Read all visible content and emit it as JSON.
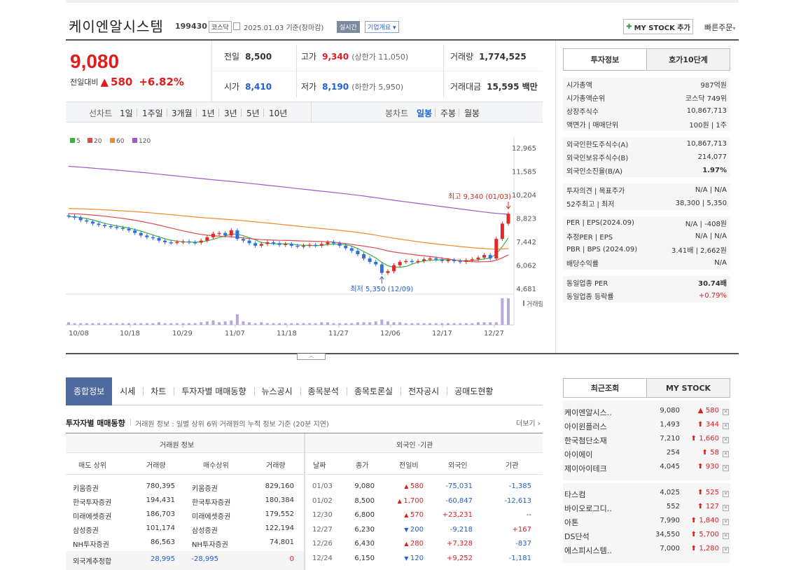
{
  "header": {
    "name": "케이엔알시스템",
    "code": "199430",
    "market": "코스닥",
    "date": "2025.01.03",
    "basis": "기준(장마감)",
    "realtime": "실시간",
    "company_info": "기업개요",
    "mystock_btn": "MY STOCK 추가",
    "quick_order": "빠른주문"
  },
  "quote": {
    "price": "9,080",
    "change_label": "전일대비",
    "change": "580",
    "change_pct": "+6.82%",
    "prev_label": "전일",
    "prev": "8,500",
    "high_label": "고가",
    "high": "9,340",
    "upper_limit": "(상한가 11,050)",
    "volume_label": "거래량",
    "volume": "1,774,525",
    "open_label": "시가",
    "open": "8,410",
    "low_label": "저가",
    "low": "8,190",
    "lower_limit": "(하한가 5,950)",
    "amount_label": "거래대금",
    "amount": "15,595",
    "amount_unit": "백만"
  },
  "periods": {
    "line_label": "선차트",
    "line": [
      "1일",
      "1주일",
      "3개월",
      "1년",
      "3년",
      "5년",
      "10년"
    ],
    "candle_label": "봉차트",
    "candle": [
      "일봉",
      "주봉",
      "월봉"
    ],
    "active_candle": "일봉"
  },
  "chart_data": {
    "type": "candlestick",
    "legend": [
      {
        "name": "5",
        "color": "#3cb043"
      },
      {
        "name": "20",
        "color": "#e0484f"
      },
      {
        "name": "60",
        "color": "#ef8a2a"
      },
      {
        "name": "120",
        "color": "#9b59c9"
      }
    ],
    "y_ticks": [
      "12,965",
      "11,585",
      "10,204",
      "8,823",
      "7,442",
      "6,062",
      "4,681"
    ],
    "ylim": [
      4681,
      12965
    ],
    "x_ticks": [
      "10/08",
      "10/18",
      "10/29",
      "11/07",
      "11/18",
      "11/27",
      "12/06",
      "12/17",
      "12/27"
    ],
    "high_note": "최고 9,340 (01/03)",
    "low_note": "최저 5,350 (12/09)",
    "volume_label": "거래량",
    "closes": [
      8930,
      8850,
      8700,
      8620,
      8500,
      8420,
      8350,
      8300,
      8250,
      8200,
      8100,
      7950,
      7800,
      7700,
      7650,
      7500,
      7400,
      7380,
      7420,
      7450,
      7400,
      7380,
      7500,
      7700,
      7900,
      7950,
      7800,
      8100,
      7600,
      7500,
      7350,
      7200,
      7300,
      7400,
      7350,
      7250,
      7300,
      7200,
      7150,
      7200,
      7250,
      7200,
      7300,
      7400,
      7350,
      7200,
      7050,
      6900,
      6700,
      6450,
      6250,
      6100,
      5600,
      5700,
      6050,
      6250,
      6300,
      6250,
      6300,
      6400,
      6450,
      6400,
      6300,
      6350,
      6300,
      6250,
      6350,
      6400,
      6500,
      6650,
      6450,
      7600,
      8500,
      9080
    ],
    "volumes": [
      3,
      2,
      2,
      2,
      2,
      2,
      2,
      2,
      2,
      2,
      2,
      2,
      2,
      2,
      2,
      3,
      2,
      2,
      2,
      2,
      2,
      2,
      3,
      4,
      5,
      3,
      4,
      5,
      12,
      4,
      3,
      2,
      3,
      2,
      2,
      2,
      2,
      2,
      2,
      2,
      2,
      2,
      3,
      3,
      2,
      2,
      2,
      2,
      3,
      3,
      3,
      4,
      6,
      4,
      3,
      3,
      2,
      2,
      2,
      2,
      2,
      2,
      2,
      2,
      2,
      2,
      2,
      2,
      3,
      3,
      3,
      3,
      30,
      30
    ]
  },
  "invest_tabs": [
    "투자정보",
    "호가10단계"
  ],
  "invest": [
    [
      {
        "label": "시가총액",
        "value": "987억원"
      },
      {
        "label": "시가총액순위",
        "value": "코스닥 749위"
      },
      {
        "label": "상장주식수",
        "value": "10,867,713"
      },
      {
        "label": "액면가 | 매매단위",
        "value": "100원 | 1주"
      }
    ],
    [
      {
        "label": "외국인한도주식수(A)",
        "value": "10,867,713"
      },
      {
        "label": "외국인보유주식수(B)",
        "value": "214,077"
      },
      {
        "label": "외국인소진율(B/A)",
        "value": "1.97%"
      }
    ],
    [
      {
        "label": "투자의견 | 목표주가",
        "value": "N/A | N/A"
      },
      {
        "label": "52주최고 | 최저",
        "value": "38,300 | 5,350"
      }
    ],
    [
      {
        "label": "PER | EPS(2024.09)",
        "value": "N/A | -408원"
      },
      {
        "label": "추정PER | EPS",
        "value": "N/A | N/A"
      },
      {
        "label": "PBR | BPS (2024.09)",
        "value": "3.41배 | 2,662원"
      },
      {
        "label": "배당수익률",
        "value": "N/A"
      }
    ],
    [
      {
        "label": "동일업종 PER",
        "value": "30.74배"
      },
      {
        "label": "동일업종 등락률",
        "value": "+0.79%"
      }
    ]
  ],
  "nav_tabs": [
    "종합정보",
    "시세",
    "차트",
    "투자자별 매매동향",
    "뉴스공시",
    "종목분석",
    "종목토론실",
    "전자공시",
    "공매도현황"
  ],
  "trading": {
    "title": "투자자별 매매동향",
    "desc": "거래원 정보 : 일별 상위 6위 거래원의 누적 정보 기준 (20분 지연)",
    "more": "더보기",
    "left_header": "거래원 정보",
    "right_header": "외국인 ·기관",
    "cols": [
      "매도 상위",
      "거래량",
      "매수상위",
      "거래량",
      "날짜",
      "종가",
      "전일비",
      "외국인",
      "기관"
    ],
    "brokers": [
      {
        "sell": "키움증권",
        "sv": "780,395",
        "buy": "키움증권",
        "bv": "829,160"
      },
      {
        "sell": "한국투자증권",
        "sv": "194,431",
        "buy": "한국투자증권",
        "bv": "180,384"
      },
      {
        "sell": "미래에셋증권",
        "sv": "186,703",
        "buy": "미래에셋증권",
        "bv": "179,552"
      },
      {
        "sell": "삼성증권",
        "sv": "101,174",
        "buy": "삼성증권",
        "bv": "122,194"
      },
      {
        "sell": "NH투자증권",
        "sv": "86,563",
        "buy": "NH투자증권",
        "bv": "74,801"
      }
    ],
    "foreign_total": {
      "label": "외국계추정합",
      "sv": "28,995",
      "bv": "-28,995",
      "net": "0"
    },
    "daily": [
      {
        "date": "01/03",
        "close": "9,080",
        "diff": "580",
        "dir": "up",
        "foreign": "-75,031",
        "inst": "-1,385"
      },
      {
        "date": "01/02",
        "close": "8,500",
        "diff": "1,700",
        "dir": "up",
        "foreign": "-60,847",
        "inst": "-12,613"
      },
      {
        "date": "12/30",
        "close": "6,800",
        "diff": "570",
        "dir": "up",
        "foreign": "+23,231",
        "inst": "--"
      },
      {
        "date": "12/27",
        "close": "6,230",
        "diff": "200",
        "dir": "down",
        "foreign": "-9,218",
        "inst": "+167"
      },
      {
        "date": "12/26",
        "close": "6,430",
        "diff": "280",
        "dir": "up",
        "foreign": "+7,328",
        "inst": "-837"
      },
      {
        "date": "12/24",
        "close": "6,150",
        "diff": "120",
        "dir": "down",
        "foreign": "+9,252",
        "inst": "-1,181"
      }
    ]
  },
  "recent_tabs": [
    "최근조회",
    "MY STOCK"
  ],
  "recent": [
    {
      "name": "케이엔알시스..",
      "price": "9,080",
      "change": "580"
    },
    {
      "name": "아이윈플러스",
      "price": "1,493",
      "change": "344"
    },
    {
      "name": "한국첨단소재",
      "price": "7,210",
      "change": "1,660"
    },
    {
      "name": "아이에이",
      "price": "254",
      "change": "58"
    },
    {
      "name": "제이아이테크",
      "price": "4,045",
      "change": "930"
    },
    {
      "name": "타스컴",
      "price": "4,025",
      "change": "525"
    },
    {
      "name": "바이오로그디..",
      "price": "552",
      "change": "127"
    },
    {
      "name": "아톤",
      "price": "7,990",
      "change": "1,840"
    },
    {
      "name": "DS단석",
      "price": "34,550",
      "change": "5,700"
    },
    {
      "name": "에스피시스템..",
      "price": "7,000",
      "change": "1,280"
    }
  ]
}
